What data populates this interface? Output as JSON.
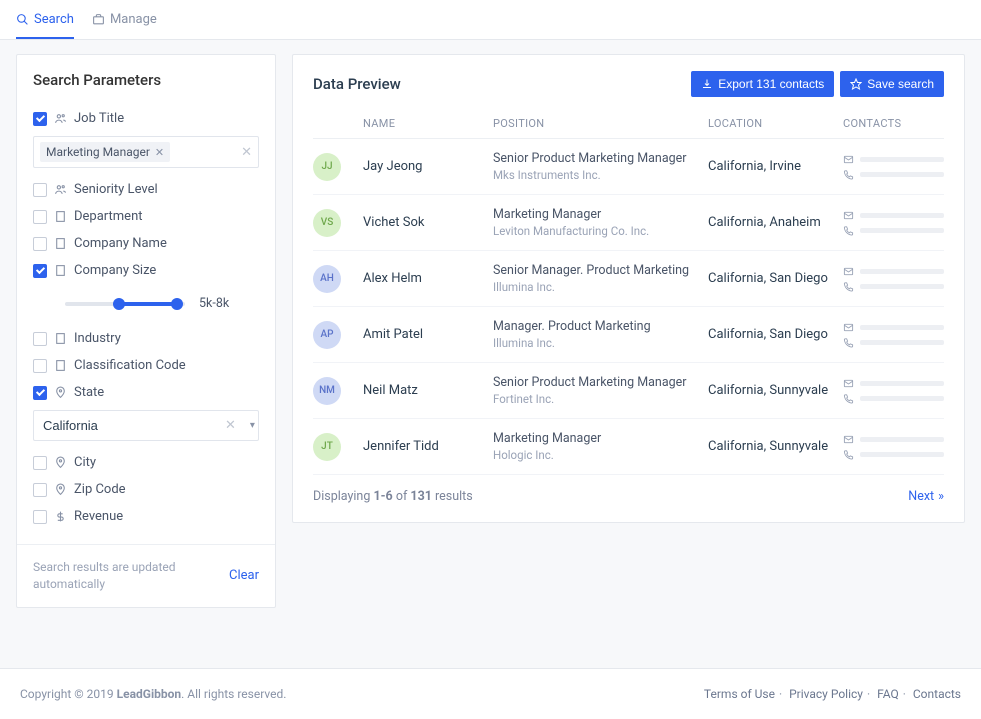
{
  "tabs": {
    "search": "Search",
    "manage": "Manage"
  },
  "sidebar": {
    "title": "Search Parameters",
    "params": {
      "job_title": "Job Title",
      "seniority": "Seniority Level",
      "department": "Department",
      "company_name": "Company Name",
      "company_size": "Company Size",
      "industry": "Industry",
      "classification": "Classification Code",
      "state": "State",
      "city": "City",
      "zip": "Zip Code",
      "revenue": "Revenue"
    },
    "chip": "Marketing Manager",
    "size_label": "5k-8k",
    "state_value": "California",
    "note": "Search results are updated automatically",
    "clear": "Clear"
  },
  "main": {
    "title": "Data Preview",
    "export": "Export 131 contacts",
    "save": "Save search",
    "headers": {
      "name": "NAME",
      "position": "POSITION",
      "location": "LOCATION",
      "contacts": "CONTACTS"
    },
    "rows": [
      {
        "initials": "JJ",
        "color": "g",
        "name": "Jay Jeong",
        "pos": "Senior Product Marketing Manager",
        "company": "Mks Instruments Inc.",
        "loc": "California, Irvine"
      },
      {
        "initials": "VS",
        "color": "g",
        "name": "Vichet Sok",
        "pos": "Marketing Manager",
        "company": "Leviton Manufacturing Co. Inc.",
        "loc": "California, Anaheim"
      },
      {
        "initials": "AH",
        "color": "b",
        "name": "Alex Helm",
        "pos": "Senior Manager. Product Marketing",
        "company": "Illumina Inc.",
        "loc": "California, San Diego"
      },
      {
        "initials": "AP",
        "color": "b",
        "name": "Amit Patel",
        "pos": "Manager. Product Marketing",
        "company": "Illumina Inc.",
        "loc": "California, San Diego"
      },
      {
        "initials": "NM",
        "color": "b",
        "name": "Neil Matz",
        "pos": "Senior Product Marketing Manager",
        "company": "Fortinet Inc.",
        "loc": "California, Sunnyvale"
      },
      {
        "initials": "JT",
        "color": "g",
        "name": "Jennifer Tidd",
        "pos": "Marketing Manager",
        "company": "Hologic Inc.",
        "loc": "California, Sunnyvale"
      }
    ],
    "displaying_pre": "Displaying ",
    "displaying_bold": "1-6",
    "displaying_mid": " of ",
    "displaying_total": "131",
    "displaying_post": " results",
    "next": "Next"
  },
  "footer": {
    "copyright_pre": "Copyright © 2019 ",
    "brand": "LeadGibbon",
    "copyright_post": ". All rights reserved.",
    "links": {
      "terms": "Terms of Use",
      "privacy": "Privacy Policy",
      "faq": "FAQ",
      "contacts": "Contacts"
    }
  }
}
